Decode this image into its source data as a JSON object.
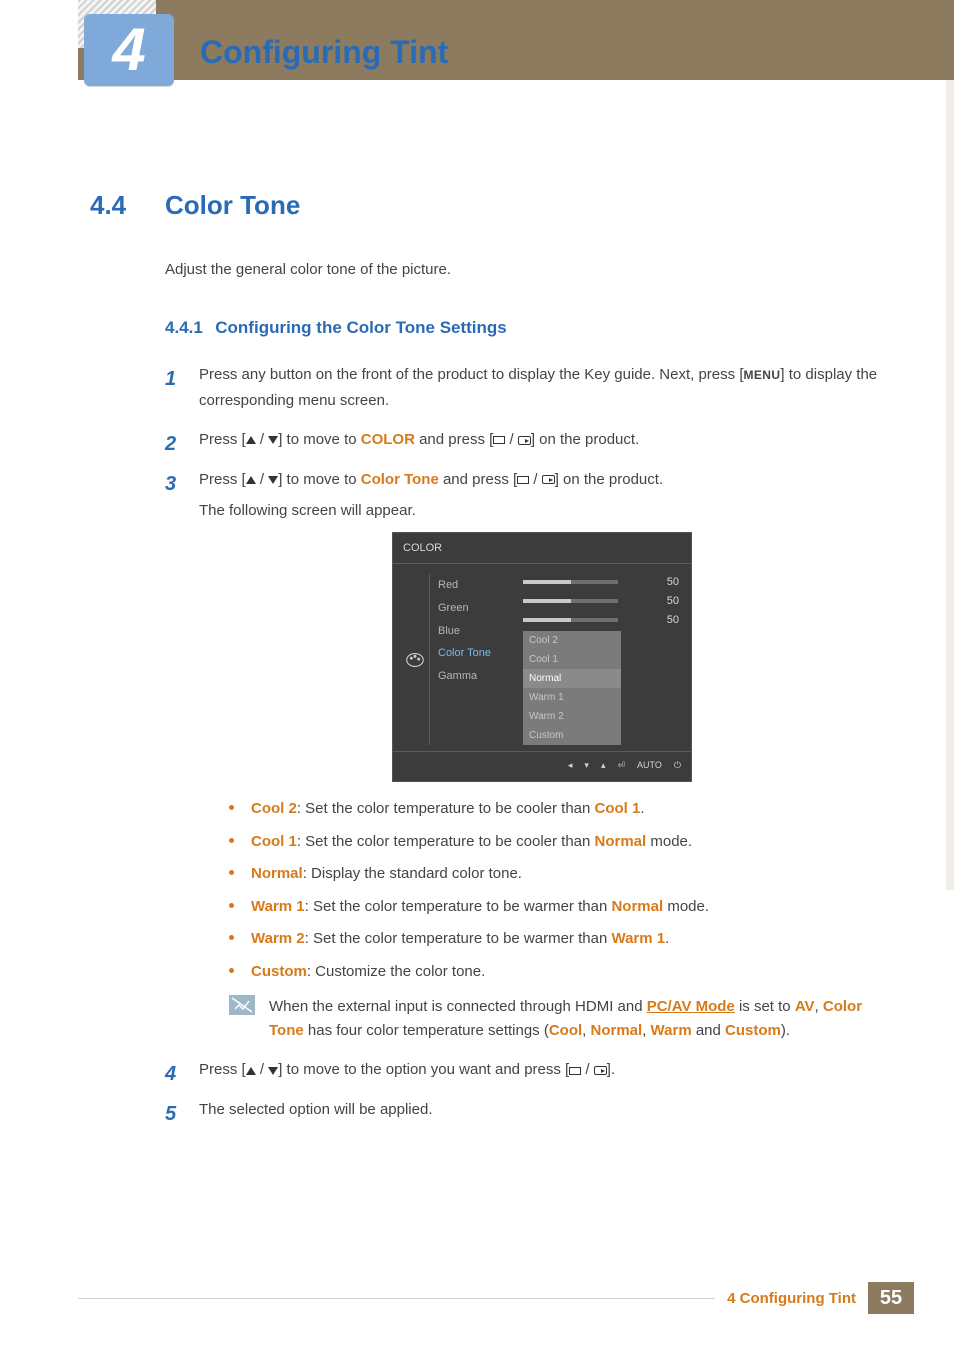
{
  "chapter": {
    "number": "4",
    "title": "Configuring Tint"
  },
  "section": {
    "number": "4.4",
    "title": "Color Tone"
  },
  "introText": "Adjust the general color tone of the picture.",
  "subsection": {
    "number": "4.4.1",
    "title": "Configuring the Color Tone Settings"
  },
  "steps": {
    "s1a": "Press any button on the front of the product to display the Key guide. Next, press [",
    "s1menu": "MENU",
    "s1b": "] to display the corresponding menu screen.",
    "s2a": "Press [",
    "s2b": "] to move to ",
    "s2kw": "COLOR",
    "s2c": " and press [",
    "s2d": "] on the product.",
    "s3a": "Press [",
    "s3b": "] to move to ",
    "s3kw": "Color Tone",
    "s3c": " and press [",
    "s3d": "] on the product.",
    "s3follow": "The following screen will appear.",
    "s4a": "Press [",
    "s4b": "] to move to the option you want and press [",
    "s4c": "].",
    "s5": "The selected option will be applied."
  },
  "osd": {
    "title": "COLOR",
    "menu": {
      "red": "Red",
      "green": "Green",
      "blue": "Blue",
      "colorTone": "Color Tone",
      "gamma": "Gamma"
    },
    "values": {
      "red": "50",
      "green": "50",
      "blue": "50",
      "pct": 50
    },
    "dropdown": {
      "o1": "Cool 2",
      "o2": "Cool 1",
      "o3": "Normal",
      "o4": "Warm 1",
      "o5": "Warm 2",
      "o6": "Custom"
    },
    "bottomAuto": "AUTO"
  },
  "descriptions": {
    "cool2": {
      "t": "Cool 2",
      "a": ": Set the color temperature to be cooler than ",
      "k": "Cool 1",
      "b": "."
    },
    "cool1": {
      "t": "Cool 1",
      "a": ": Set the color temperature to be cooler than ",
      "k": "Normal",
      "b": " mode."
    },
    "normal": {
      "t": "Normal",
      "a": ": Display the standard color tone."
    },
    "warm1": {
      "t": "Warm 1",
      "a": ": Set the color temperature to be warmer than ",
      "k": "Normal",
      "b": " mode."
    },
    "warm2": {
      "t": "Warm 2",
      "a": ": Set the color temperature to be warmer than ",
      "k": "Warm 1",
      "b": "."
    },
    "custom": {
      "t": "Custom",
      "a": ": Customize the color tone."
    }
  },
  "note": {
    "a": "When the external input is connected through HDMI and ",
    "pcav": "PC/AV Mode",
    "b": " is set to ",
    "av": "AV",
    "c": ", ",
    "ct": "Color Tone",
    "d": " has four color temperature settings (",
    "cool": "Cool",
    "normal": "Normal",
    "warm": "Warm",
    "custom": "Custom",
    "sep1": ", ",
    "sep2": ", ",
    "sep3": " and ",
    "end": ")."
  },
  "footer": {
    "label": "4 Configuring Tint",
    "page": "55"
  }
}
